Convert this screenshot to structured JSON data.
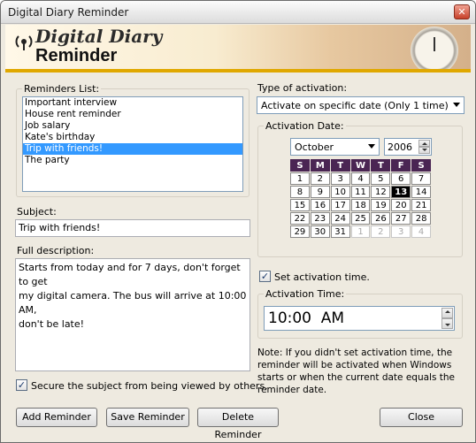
{
  "window": {
    "title": "Digital Diary Reminder"
  },
  "banner": {
    "brand_line1": "Digital Diary",
    "brand_line2": "Reminder"
  },
  "reminders": {
    "label": "Reminders List:",
    "items": [
      "Important interview",
      "House rent reminder",
      "Job salary",
      "Kate's birthday",
      "Trip with friends!",
      "The party"
    ],
    "selected_index": 4
  },
  "subject": {
    "label": "Subject:",
    "value": "Trip with friends!"
  },
  "description": {
    "label": "Full description:",
    "line1": "Starts from today and for 7 days, don't forget to get",
    "line2": "my digital camera. The bus will arrive at 10:00 AM,",
    "line3": "don't be late!"
  },
  "secure": {
    "label": "Secure the subject from being viewed by others.",
    "checked": true
  },
  "buttons": {
    "add": "Add Reminder",
    "save": "Save Reminder",
    "delete": "Delete Reminder",
    "close": "Close"
  },
  "activation": {
    "type_label": "Type of activation:",
    "type_value": "Activate on specific date (Only 1 time)",
    "date_label": "Activation Date:",
    "month": "October",
    "year": "2006",
    "weekdays": [
      "S",
      "M",
      "T",
      "W",
      "T",
      "F",
      "S"
    ],
    "weeks": [
      [
        "1",
        "2",
        "3",
        "4",
        "5",
        "6",
        "7"
      ],
      [
        "8",
        "9",
        "10",
        "11",
        "12",
        "13",
        "14"
      ],
      [
        "15",
        "16",
        "17",
        "18",
        "19",
        "20",
        "21"
      ],
      [
        "22",
        "23",
        "24",
        "25",
        "26",
        "27",
        "28"
      ],
      [
        "29",
        "30",
        "31",
        "1",
        "2",
        "3",
        "4"
      ]
    ],
    "today": "13",
    "set_time_label": "Set activation time.",
    "set_time_checked": true,
    "time_label": "Activation Time:",
    "time_value": "10:00  AM",
    "note": "Note: If you didn't set activation time, the reminder will be activated when Windows starts or when the current date equals the reminder date."
  }
}
